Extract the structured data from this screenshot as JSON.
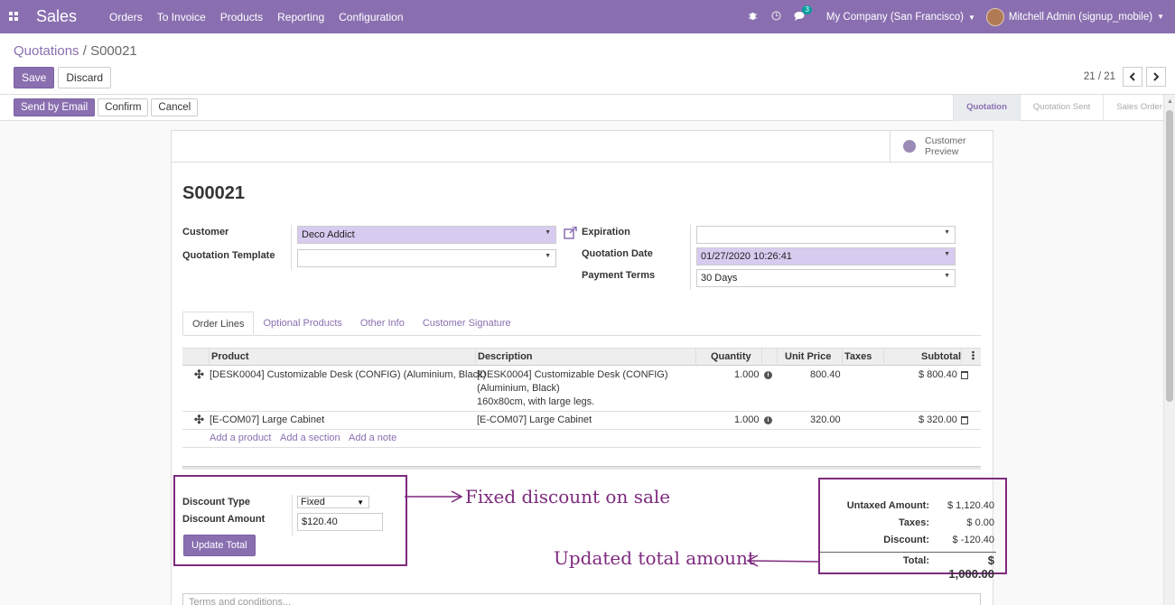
{
  "navbar": {
    "app_name": "Sales",
    "menu": [
      "Orders",
      "To Invoice",
      "Products",
      "Reporting",
      "Configuration"
    ],
    "message_count": "3",
    "company": "My Company (San Francisco)",
    "user": "Mitchell Admin (signup_mobile)"
  },
  "breadcrumb": {
    "parent": "Quotations",
    "separator": "/",
    "current": "S00021"
  },
  "buttons": {
    "save": "Save",
    "discard": "Discard"
  },
  "pager": {
    "value": "21 / 21"
  },
  "status_actions": {
    "send_email": "Send by Email",
    "confirm": "Confirm",
    "cancel": "Cancel"
  },
  "stages": [
    "Quotation",
    "Quotation Sent",
    "Sales Order"
  ],
  "preview": {
    "line1": "Customer",
    "line2": "Preview"
  },
  "order": {
    "name": "S00021",
    "customer_label": "Customer",
    "customer": "Deco Addict",
    "template_label": "Quotation Template",
    "template": "",
    "expiration_label": "Expiration",
    "expiration": "",
    "date_label": "Quotation Date",
    "date": "01/27/2020 10:26:41",
    "terms_label": "Payment Terms",
    "terms": "30 Days"
  },
  "tabs": [
    "Order Lines",
    "Optional Products",
    "Other Info",
    "Customer Signature"
  ],
  "table": {
    "headers": {
      "product": "Product",
      "description": "Description",
      "quantity": "Quantity",
      "unit_price": "Unit Price",
      "taxes": "Taxes",
      "subtotal": "Subtotal"
    },
    "rows": [
      {
        "product": "[DESK0004] Customizable Desk (CONFIG) (Aluminium, Black)",
        "desc1": "[DESK0004] Customizable Desk (CONFIG)",
        "desc2": "(Aluminium, Black)",
        "desc3": "160x80cm, with large legs.",
        "quantity": "1.000",
        "unit_price": "800.40",
        "subtotal": "$ 800.40"
      },
      {
        "product": "[E-COM07] Large Cabinet",
        "desc1": "[E-COM07] Large Cabinet",
        "quantity": "1.000",
        "unit_price": "320.00",
        "subtotal": "$ 320.00"
      }
    ],
    "add_product": "Add a product",
    "add_section": "Add a section",
    "add_note": "Add a note"
  },
  "discount": {
    "type_label": "Discount Type",
    "type": "Fixed",
    "amount_label": "Discount Amount",
    "amount": "$120.40",
    "update_button": "Update Total"
  },
  "totals": {
    "untaxed_label": "Untaxed Amount:",
    "untaxed": "$ 1,120.40",
    "taxes_label": "Taxes:",
    "taxes": "$ 0.00",
    "discount_label": "Discount:",
    "discount": "$ -120.40",
    "total_label": "Total:",
    "total": "$ 1,000.00"
  },
  "annotations": {
    "fixed": "Fixed  discount  on  sale",
    "updated": "Updated  total  amount"
  },
  "terms_placeholder": "Terms and conditions...",
  "colors": {
    "brand": "#8a6fb0",
    "annotation": "#7e2a7e"
  }
}
